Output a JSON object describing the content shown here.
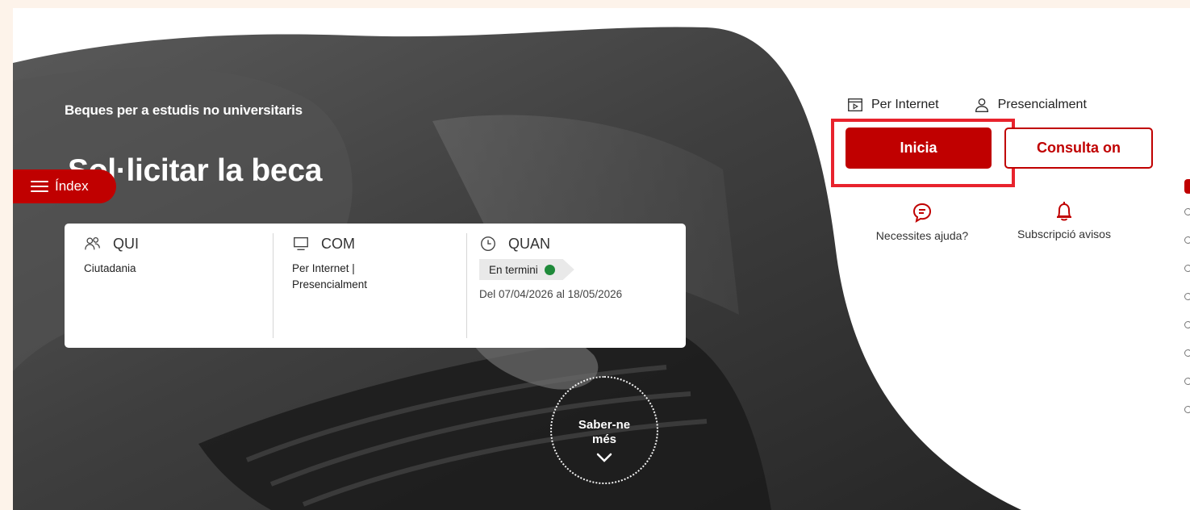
{
  "hero": {
    "eyebrow": "Beques per a estudis no universitaris",
    "title": "Sol·licitar la beca",
    "index_button_label": "Índex",
    "learn_more": {
      "line1": "Saber-ne",
      "line2": "més"
    }
  },
  "info_card": {
    "qui": {
      "heading": "QUI",
      "value": "Ciutadania",
      "icon": "people-icon"
    },
    "com": {
      "heading": "COM",
      "value_line1": "Per Internet |",
      "value_line2": "Presencialment",
      "icon": "monitor-icon"
    },
    "quan": {
      "heading": "QUAN",
      "status": "En termini",
      "status_color": "#1f8a3a",
      "dates": "Del 07/04/2026 al 18/05/2026",
      "icon": "clock-icon"
    }
  },
  "actions": {
    "channels": [
      {
        "label": "Per Internet",
        "icon": "internet-window-icon"
      },
      {
        "label": "Presencialment",
        "icon": "person-icon"
      }
    ],
    "start_label": "Inicia",
    "consult_label": "Consulta on",
    "help_label": "Necessites ajuda?",
    "notify_label": "Subscripció avisos"
  },
  "colors": {
    "brand_red": "#c00000",
    "highlight_red": "#e8232d",
    "page_background": "#fdf3ea"
  }
}
